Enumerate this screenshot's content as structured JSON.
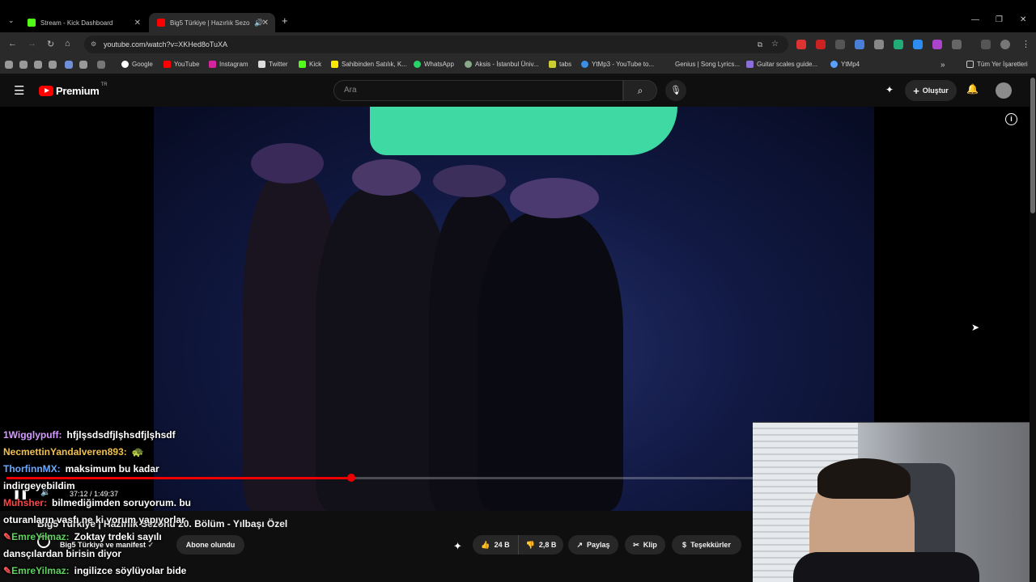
{
  "browser": {
    "tabs": [
      {
        "title": "Stream - Kick Dashboard"
      },
      {
        "title": "Big5 Türkiye | Hazırlık Sezo"
      }
    ],
    "url": "youtube.com/watch?v=XKHed8oTuXA",
    "bookmarks": [
      "Google",
      "YouTube",
      "Instagram",
      "Twitter",
      "Kick",
      "Sahibinden Satılık, K...",
      "WhatsApp",
      "Aksis - İstanbul Üniv...",
      "tabs",
      "YtMp3 - YouTube to...",
      "Genius | Song Lyrics...",
      "Guitar scales guide...",
      "YtMp4"
    ],
    "all_bookmarks": "Tüm Yer İşaretleri"
  },
  "youtube": {
    "logo": "Premium",
    "logo_region": "TR",
    "search_placeholder": "Ara",
    "create_label": "Oluştur",
    "video_title": "Big5 Türkiye | Hazırlık Sezonu 20. Bölüm - Yılbaşı Özel",
    "channel_name": "Big5 Türkiye ve manifest",
    "subscribe_label": "Abone olundu",
    "likes": "24 B",
    "dislikes": "2,8 B",
    "share_label": "Paylaş",
    "clip_label": "Klip",
    "thanks_label": "Teşekkürler",
    "time_current": "37:12",
    "time_total": "1:49:37",
    "time_display": "37:12 / 1:49:37",
    "progress_fraction": 0.339
  },
  "chat": [
    {
      "user": "1Wigglypuff:",
      "message": "hfjlşsdsdfjlşhsdfjlşhsdf",
      "color": "#d59bff"
    },
    {
      "user": "NecmettinYandalveren893:",
      "message": "",
      "color": "#f0c04a"
    },
    {
      "user": "ThorfinnMX:",
      "message": "maksimum bu kadar",
      "color": "#6aa9ff"
    },
    {
      "user": "",
      "message": "indirgeyebildim",
      "color": "#ffffff"
    },
    {
      "user": "Muhsher:",
      "message": "bilmediğimden soruyorum. bu",
      "color": "#ff4444"
    },
    {
      "user": "",
      "message": "oturanların vasfı ne ki yorum yapıyorlar",
      "color": "#ffffff"
    },
    {
      "user": "EmreYilmaz:",
      "message": "Zoktay trdeki sayılı",
      "color": "#5fd35f"
    },
    {
      "user": "",
      "message": "dansçılardan birisin diyor",
      "color": "#ffffff"
    },
    {
      "user": "EmreYilmaz:",
      "message": "ingilizce söylüyolar bide",
      "color": "#5fd35f"
    }
  ],
  "colors": {
    "accent_red": "#ff0000",
    "progress": "#ee0000",
    "stage_logo": "#3fd9a4"
  }
}
